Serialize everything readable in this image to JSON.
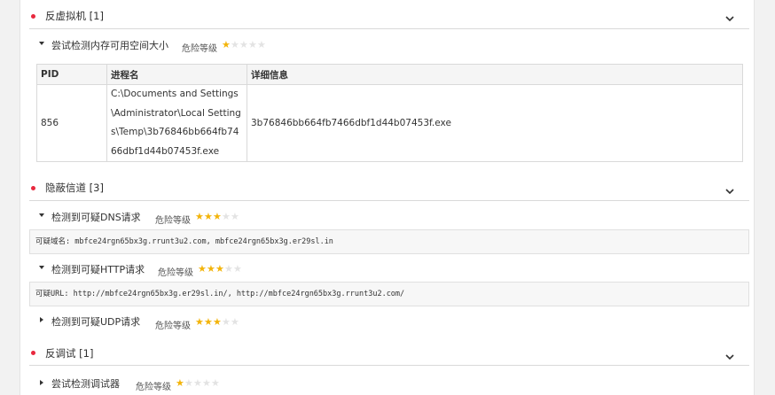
{
  "categories": [
    {
      "title": "反虚拟机 [1]",
      "items": [
        {
          "title": "尝试检测内存可用空间大小",
          "risk_label": "危险等级",
          "stars": 1,
          "table": {
            "headers": [
              "PID",
              "进程名",
              "详细信息"
            ],
            "rows": [
              {
                "pid": "856",
                "process": "C:\\Documents and Settings\\Administrator\\Local Settings\\Temp\\3b76846bb664fb7466dbf1d44b07453f.exe",
                "detail": "3b76846bb664fb7466dbf1d44b07453f.exe"
              }
            ]
          }
        }
      ]
    },
    {
      "title": "隐蔽信道 [3]",
      "items": [
        {
          "title": "检测到可疑DNS请求",
          "risk_label": "危险等级",
          "stars": 3,
          "info": "可疑域名: mbfce24rgn65bx3g.rrunt3u2.com, mbfce24rgn65bx3g.er29sl.in"
        },
        {
          "title": "检测到可疑HTTP请求",
          "risk_label": "危险等级",
          "stars": 3,
          "info": "可疑URL: http://mbfce24rgn65bx3g.er29sl.in/, http://mbfce24rgn65bx3g.rrunt3u2.com/"
        },
        {
          "title": "检测到可疑UDP请求",
          "risk_label": "危险等级",
          "stars": 3
        }
      ]
    },
    {
      "title": "反调试 [1]",
      "items": [
        {
          "title": "尝试检测调试器",
          "risk_label": "危险等级",
          "stars": 1
        }
      ]
    }
  ],
  "colors": {
    "bullet": "#e8283e",
    "star_on": "#f3b40a",
    "star_off": "#e3e3e3"
  }
}
